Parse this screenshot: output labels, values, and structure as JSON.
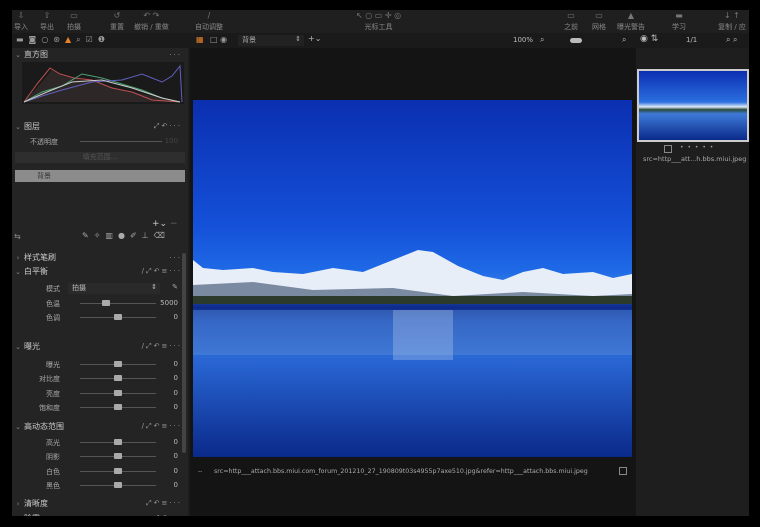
{
  "toolbar": {
    "items": [
      "导入",
      "导出",
      "拍摄",
      "重置",
      "撤销 / 重做",
      "自动调整",
      "光标工具",
      "之前",
      "网格",
      "曝光警告",
      "学习",
      "复制 / 应用"
    ]
  },
  "viewer_bar": {
    "variant": "背景",
    "zoom": "100%",
    "count": "1/1"
  },
  "panels": {
    "histogram": "直方图",
    "layers": {
      "title": "图层",
      "opacity_label": "不透明度",
      "opacity_value": "100",
      "fill_mask": "填充范围...",
      "layer_name": "背景"
    },
    "style_brush": "样式笔刷",
    "white_balance": {
      "title": "白平衡",
      "mode_label": "模式",
      "mode_value": "拍摄",
      "rows": [
        {
          "label": "色温",
          "value": "5000",
          "pos": 0.34
        },
        {
          "label": "色调",
          "value": "0",
          "pos": 0.5
        }
      ]
    },
    "exposure": {
      "title": "曝光",
      "rows": [
        {
          "label": "曝光",
          "value": "0",
          "pos": 0.5
        },
        {
          "label": "对比度",
          "value": "0",
          "pos": 0.5
        },
        {
          "label": "亮度",
          "value": "0",
          "pos": 0.5
        },
        {
          "label": "饱和度",
          "value": "0",
          "pos": 0.5
        }
      ]
    },
    "hdr": {
      "title": "高动态范围",
      "rows": [
        {
          "label": "高光",
          "value": "0",
          "pos": 0.5
        },
        {
          "label": "阴影",
          "value": "0",
          "pos": 0.5
        },
        {
          "label": "白色",
          "value": "0",
          "pos": 0.5
        },
        {
          "label": "黑色",
          "value": "0",
          "pos": 0.5
        }
      ]
    },
    "clarity": "清晰度",
    "dehaze": "除雾"
  },
  "viewer": {
    "filename": "src=http___attach.bbs.miui.com_forum_201210_27_190809t03s4955p7axe510.jpg&refer=http___attach.bbs.miui.jpeg",
    "dash": "--"
  },
  "browser": {
    "thumb_name": "src=http___att...h.bbs.miui.jpeg",
    "rating": "• • • • •"
  },
  "colors": {
    "accent": "#e8822a"
  }
}
